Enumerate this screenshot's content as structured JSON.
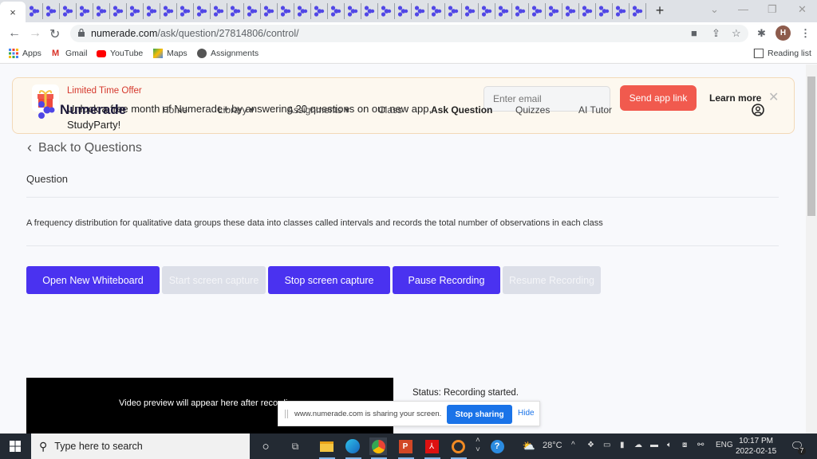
{
  "browser": {
    "active_tab_close": "×",
    "tab_count": 37,
    "tab_icon": "numerade-favicon",
    "new_tab": "+",
    "window_controls": {
      "dropdown": "⌄",
      "minimize": "—",
      "restore": "❐",
      "close": "✕"
    },
    "url_domain": "numerade.com",
    "url_path": "/ask/question/27814806/control/",
    "profile_initial": "H",
    "bookmarks": [
      "Apps",
      "Gmail",
      "YouTube",
      "Maps",
      "Assignments"
    ],
    "reading_list": "Reading list"
  },
  "banner": {
    "title": "Limited Time Offer",
    "text": "Unlock a free month of Numerade+ by answering 20 questions on our new app, StudyParty!",
    "email_placeholder": "Enter email",
    "send_button": "Send app link",
    "learn_more": "Learn more",
    "close": "✕"
  },
  "nav": {
    "brand": "Numerade",
    "links": [
      {
        "label": "Home"
      },
      {
        "label": "Library ▾"
      },
      {
        "label": "Assignments ▾"
      },
      {
        "label": "Class"
      },
      {
        "label": "Ask Question",
        "active": true
      },
      {
        "label": "Quizzes"
      },
      {
        "label": "AI Tutor"
      }
    ]
  },
  "main": {
    "back": "Back to Questions",
    "question_label": "Question",
    "question_text": "A frequency distribution for qualitative data groups these data into classes called intervals and records the total number of observations in each class",
    "buttons": [
      {
        "label": "Open New Whiteboard",
        "enabled": true
      },
      {
        "label": "Start screen capture",
        "enabled": false
      },
      {
        "label": "Stop screen capture",
        "enabled": true
      },
      {
        "label": "Pause Recording",
        "enabled": true
      },
      {
        "label": "Resume Recording",
        "enabled": false
      }
    ],
    "video_placeholder": "Video preview will appear here after recording",
    "status": "Status: Recording started."
  },
  "sharebar": {
    "text": "www.numerade.com is sharing your screen.",
    "stop": "Stop sharing",
    "hide": "Hide"
  },
  "taskbar": {
    "search_placeholder": "Type here to search",
    "temperature": "28°C",
    "language": "ENG",
    "time": "10:17 PM",
    "date": "2022-02-15",
    "notifications": "7"
  }
}
